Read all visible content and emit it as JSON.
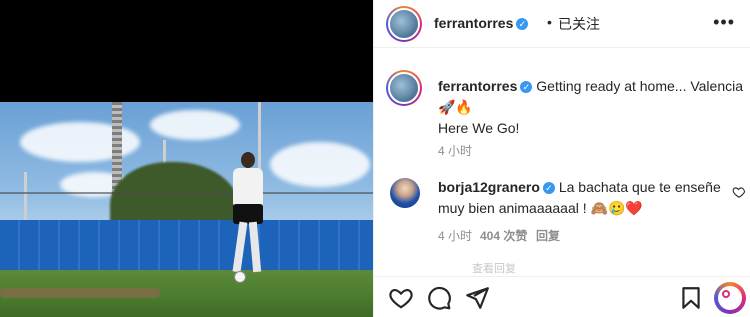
{
  "post": {
    "author": "ferrantorres",
    "separator": "•",
    "follow_label": "已关注",
    "more_icon": "more-horizontal-icon",
    "caption_text": "Getting ready at home... Valencia 🚀🔥",
    "caption_line2": "Here We Go!",
    "caption_time": "4 小时"
  },
  "comments": [
    {
      "user": "borja12granero",
      "text": "La bachata que te enseñe muy bien animaaaaaal ! 🙈🥲❤️",
      "time": "4 小时",
      "likes": "404 次赞",
      "reply_label": "回复"
    }
  ],
  "faded_text": "查看回复",
  "colors": {
    "verified": "#3897f0",
    "meta": "#8e8e8e",
    "heart": "#ed4956"
  },
  "icons": {
    "like": "heart-icon",
    "comment": "comment-icon",
    "share": "share-icon",
    "save": "bookmark-icon",
    "reel": "reels-icon"
  }
}
